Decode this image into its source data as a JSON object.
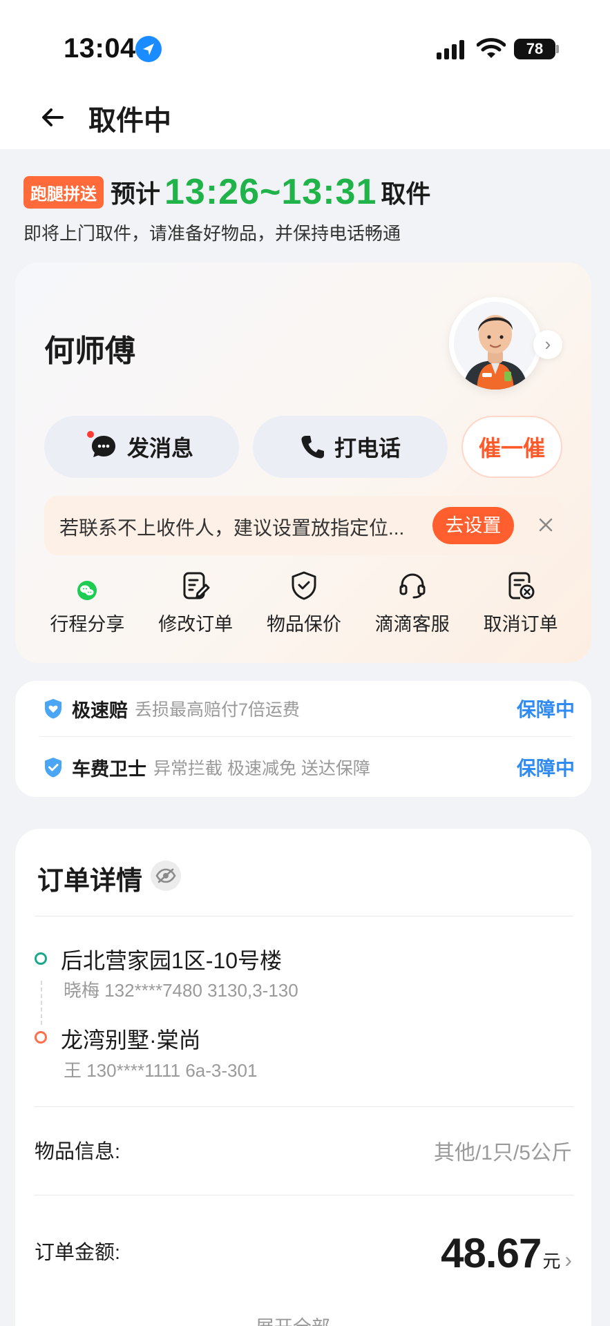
{
  "status_bar": {
    "time": "13:04",
    "battery": "78"
  },
  "nav": {
    "title": "取件中"
  },
  "header": {
    "service_tag": "跑腿拼送",
    "eta_prefix": "预计",
    "eta_time": "13:26~13:31",
    "eta_suffix": "取件",
    "hint": "即将上门取件，请准备好物品，并保持电话畅通"
  },
  "courier": {
    "name": "何师傅",
    "buttons": {
      "message": "发消息",
      "call": "打电话",
      "urge": "催一催"
    },
    "notice": {
      "text": "若联系不上收件人，建议设置放指定位...",
      "action": "去设置"
    },
    "actions": [
      {
        "label": "行程分享",
        "icon": "wechat-icon"
      },
      {
        "label": "修改订单",
        "icon": "edit-order-icon"
      },
      {
        "label": "物品保价",
        "icon": "shield-check-icon"
      },
      {
        "label": "滴滴客服",
        "icon": "headset-icon"
      },
      {
        "label": "取消订单",
        "icon": "cancel-order-icon"
      }
    ]
  },
  "insurance": [
    {
      "title": "极速赔",
      "desc": "丢损最高赔付7倍运费",
      "status": "保障中"
    },
    {
      "title": "车费卫士",
      "desc": "异常拦截 极速减免 送达保障",
      "status": "保障中"
    }
  ],
  "order": {
    "title": "订单详情",
    "pickup": {
      "name": "后北营家园1区-10号楼",
      "contact": "晓梅 132****7480 3130,3-130"
    },
    "dropoff": {
      "name": "龙湾别墅·棠尚",
      "contact": "王 130****1111 6a-3-301"
    },
    "item_label": "物品信息:",
    "item_value": "其他/1只/5公斤",
    "amount_label": "订单金额:",
    "amount_value": "48.67",
    "amount_unit": "元",
    "expand_all": "展开全部"
  },
  "colors": {
    "eta_green": "#1fb34a",
    "accent_orange": "#ff5f2e",
    "status_blue": "#2f8bf0"
  }
}
